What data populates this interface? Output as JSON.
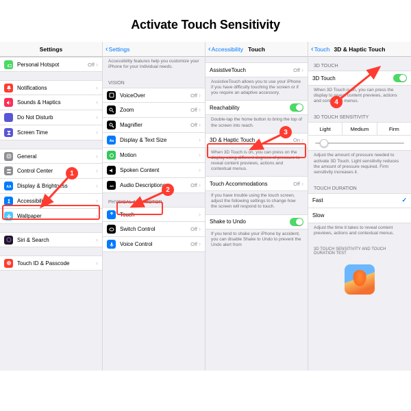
{
  "title": "Activate Touch Sensitivity",
  "annotations": {
    "b1": "1",
    "b2": "2",
    "b3": "3",
    "b4": "4"
  },
  "panel1": {
    "nav_title": "Settings",
    "rows": [
      {
        "label": "Personal Hotspot",
        "detail": "Off",
        "icon": "#4cd964",
        "glyph": "link"
      },
      {
        "label": "Notifications",
        "icon": "#ff3b30",
        "glyph": "bell"
      },
      {
        "label": "Sounds & Haptics",
        "icon": "#ff2d55",
        "glyph": "sound"
      },
      {
        "label": "Do Not Disturb",
        "icon": "#5856d6",
        "glyph": "moon"
      },
      {
        "label": "Screen Time",
        "icon": "#5856d6",
        "glyph": "hourglass"
      },
      {
        "label": "General",
        "icon": "#8e8e93",
        "glyph": "gear"
      },
      {
        "label": "Control Center",
        "icon": "#8e8e93",
        "glyph": "switches"
      },
      {
        "label": "Display & Brightness",
        "icon": "#007aff",
        "glyph": "AA"
      },
      {
        "label": "Accessibility",
        "icon": "#007aff",
        "glyph": "person"
      },
      {
        "label": "Wallpaper",
        "icon": "#54c7fc",
        "glyph": "flower"
      },
      {
        "label": "Siri & Search",
        "icon": "#1b1b1d",
        "glyph": "siri"
      },
      {
        "label": "Touch ID & Passcode",
        "icon": "#ff3b30",
        "glyph": "touchid"
      }
    ]
  },
  "panel2": {
    "back": "Settings",
    "intro": "Accessibility features help you customize your iPhone for your individual needs.",
    "h_vision": "VISION",
    "vision": [
      {
        "label": "VoiceOver",
        "detail": "Off",
        "icon": "#000",
        "glyph": "vo"
      },
      {
        "label": "Zoom",
        "detail": "Off",
        "icon": "#000",
        "glyph": "zoom"
      },
      {
        "label": "Magnifier",
        "detail": "Off",
        "icon": "#000",
        "glyph": "mag"
      },
      {
        "label": "Display & Text Size",
        "icon": "#007aff",
        "glyph": "Aa"
      },
      {
        "label": "Motion",
        "icon": "#34c759",
        "glyph": "motion"
      },
      {
        "label": "Spoken Content",
        "icon": "#000",
        "glyph": "speak"
      },
      {
        "label": "Audio Descriptions",
        "detail": "Off",
        "icon": "#000",
        "glyph": "ad"
      }
    ],
    "h_motor": "PHYSICAL AND MOTOR",
    "motor": [
      {
        "label": "Touch",
        "icon": "#007aff",
        "glyph": "touch"
      },
      {
        "label": "Switch Control",
        "detail": "Off",
        "icon": "#000",
        "glyph": "switch"
      },
      {
        "label": "Voice Control",
        "detail": "Off",
        "icon": "#007aff",
        "glyph": "voice"
      }
    ]
  },
  "panel3": {
    "back": "Accessibility",
    "nav_title": "Touch",
    "at_label": "AssistiveTouch",
    "at_detail": "Off",
    "at_note": "AssistiveTouch allows you to use your iPhone if you have difficulty touching the screen or if you require an adaptive accessory.",
    "reach": "Reachability",
    "reach_note": "Double-tap the home button to bring the top of the screen into reach.",
    "haptic": "3D & Haptic Touch",
    "haptic_detail": "On",
    "haptic_note": "When 3D Touch is on, you can press on the display using different degrees of pressure to reveal content previews, actions and contextual menus.",
    "accom": "Touch Accommodations",
    "accom_detail": "Off",
    "accom_note": "If you have trouble using the touch screen, adjust the following settings to change how the screen will respond to touch.",
    "shake": "Shake to Undo",
    "shake_note": "If you tend to shake your iPhone by accident, you can disable Shake to Undo to prevent the Undo alert from"
  },
  "panel4": {
    "back": "Touch",
    "nav_title": "3D & Haptic Touch",
    "h_3d": "3D TOUCH",
    "row_3d": "3D Touch",
    "note_3d": "When 3D Touch is on, you can press the display to reveal content previews, actions and contextual menus.",
    "h_sens": "3D TOUCH SENSITIVITY",
    "seg": [
      "Light",
      "Medium",
      "Firm"
    ],
    "note_sens": "Adjust the amount of pressure needed to activate 3D Touch. Light sensitivity reduces the amount of pressure required. Firm sensitivity increases it.",
    "h_dur": "TOUCH DURATION",
    "fast": "Fast",
    "slow": "Slow",
    "note_dur": "Adjust the time it takes to reveal content previews, actions and contextual menus.",
    "h_test": "3D TOUCH SENSITIVITY AND TOUCH DURATION TEST"
  }
}
